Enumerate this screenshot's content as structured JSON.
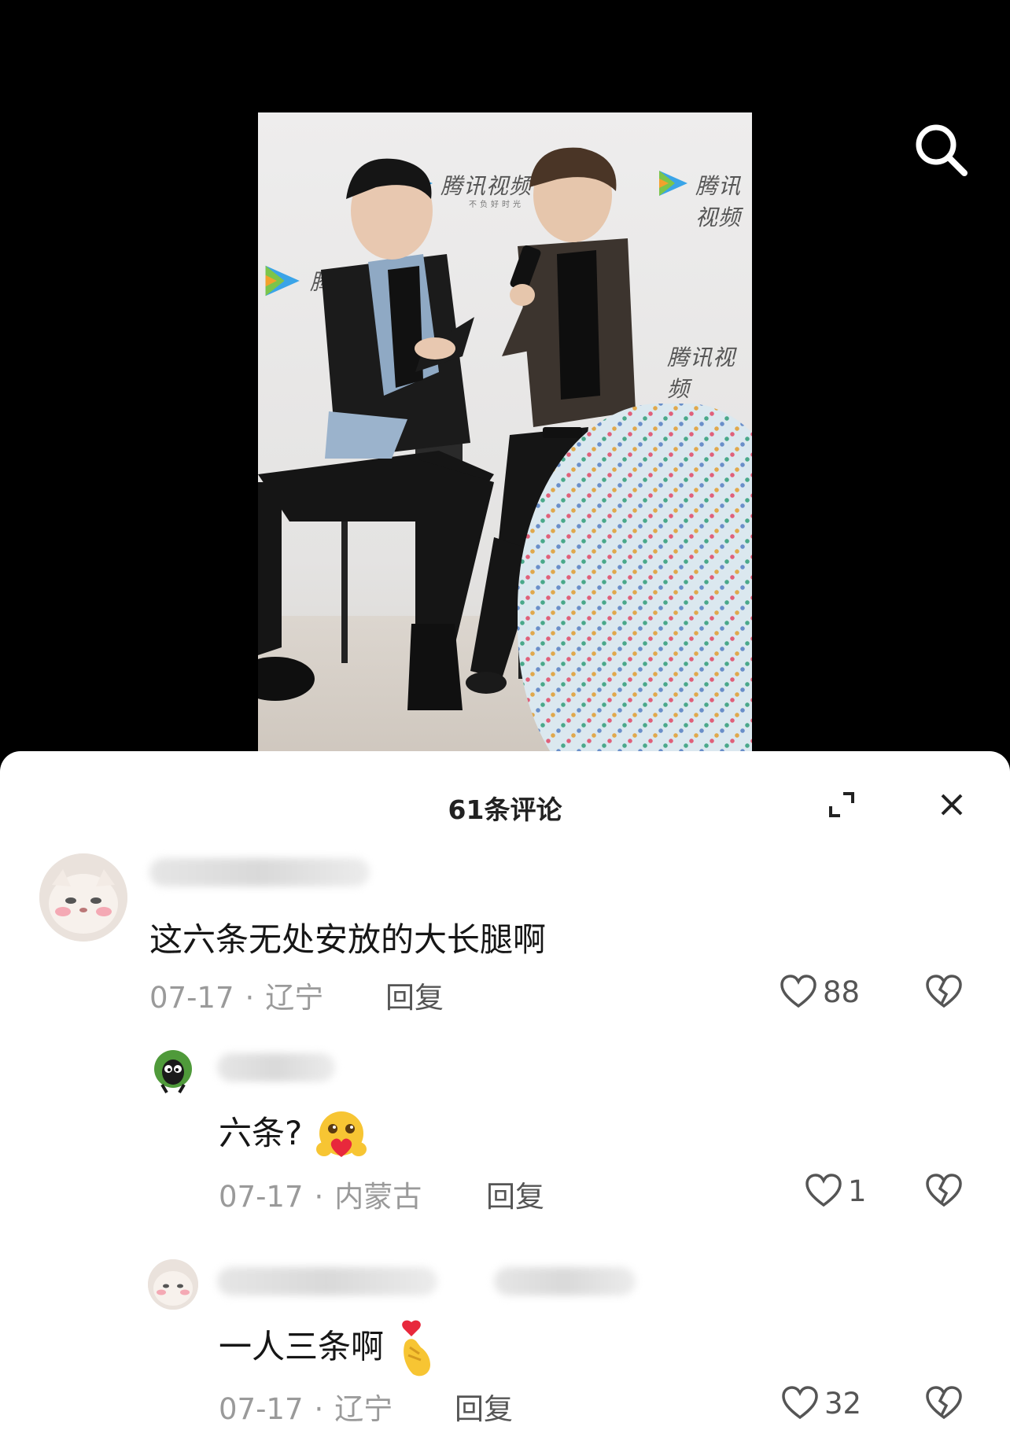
{
  "comments_panel": {
    "title": "61条评论"
  },
  "comments": [
    {
      "text": "这六条无处安放的大长腿啊",
      "date": "07-17",
      "location": "辽宁",
      "reply_label": "回复",
      "likes": "88"
    },
    {
      "text": "六条?",
      "date": "07-17",
      "location": "内蒙古",
      "reply_label": "回复",
      "likes": "1"
    },
    {
      "text": "一人三条啊",
      "date": "07-17",
      "location": "辽宁",
      "reply_label": "回复",
      "likes": "32"
    }
  ],
  "video": {
    "backdrop_text": "腾讯视频",
    "backdrop_subtext": "不负好时光"
  },
  "icons": {
    "search": "search-icon",
    "expand": "expand-icon",
    "close": "close-icon",
    "like": "heart-outline-icon",
    "dislike": "broken-heart-icon"
  }
}
